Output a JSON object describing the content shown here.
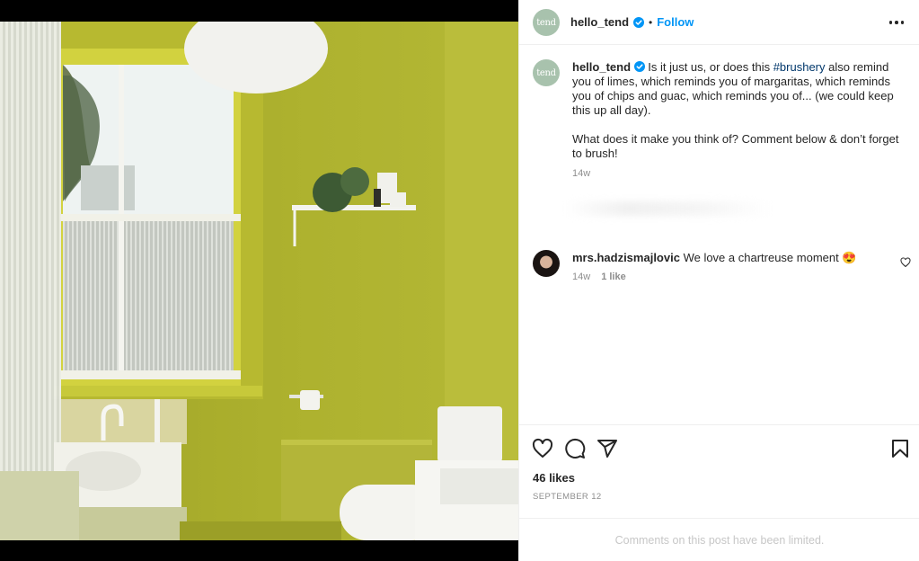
{
  "post": {
    "image_alt": "Chartreuse green bathroom with window, shelf of plants, toilet and bathtub"
  },
  "header": {
    "avatar_text": "tend",
    "username": "hello_tend",
    "separator": "•",
    "follow_label": "Follow",
    "more_icon": "more-options-icon"
  },
  "caption": {
    "avatar_text": "tend",
    "username": "hello_tend",
    "text_before_hashtag": " Is it just us, or does this ",
    "hashtag": "#brushery",
    "text_after_hashtag": " also remind you of limes, which reminds you of margaritas, which reminds you of chips and guac, which reminds you of... (we could keep this up all day).",
    "paragraph2": "What does it make you think of? Comment below & don’t forget to brush!",
    "time": "14w"
  },
  "comment": {
    "username": "mrs.hadzismajlovic",
    "text": " We love a chartreuse moment 😍",
    "time": "14w",
    "likes": "1 like"
  },
  "actions": {
    "like_icon": "heart-icon",
    "comment_icon": "comment-icon",
    "share_icon": "share-icon",
    "save_icon": "bookmark-icon"
  },
  "likes_count": "46 likes",
  "date": "SEPTEMBER 12",
  "footer": "Comments on this post have been limited.",
  "colors": {
    "accent": "#0095f6",
    "hashtag": "#00376b",
    "wall": "#a9ad2c",
    "avatar": "#a8c2ad"
  }
}
